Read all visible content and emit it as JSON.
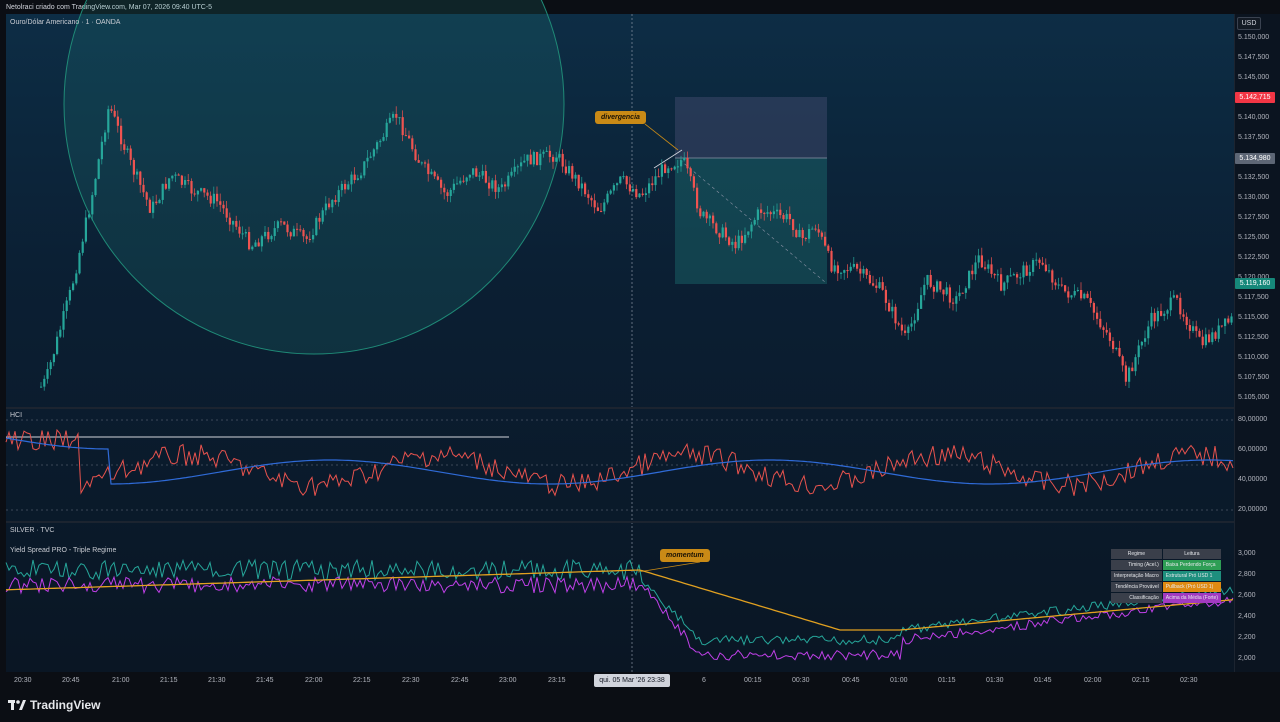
{
  "topbar": {
    "text": "Netolraci criado com TradingView.com, Mar 07, 2026 09:40 UTC-5"
  },
  "main_pane": {
    "title": "Ouro/Dólar Americano · 1 · OANDA",
    "currency_button": "USD",
    "price_ticks": [
      "5.150,000",
      "5.147,500",
      "5.145,000",
      "5.142,500",
      "5.140,000",
      "5.137,500",
      "5.132,500",
      "5.130,000",
      "5.127,500",
      "5.125,000",
      "5.122,500",
      "5.120,000",
      "5.117,500",
      "5.115,000",
      "5.112,500",
      "5.110,000",
      "5.107,500",
      "5.105,000"
    ],
    "price_tag_red": "5.142,715",
    "price_tag_grey": "5.134,980",
    "price_tag_green": "5.119,160",
    "annotation": "divergencia",
    "colors": {
      "up": "#26a69a",
      "down": "#ef5350",
      "circle": "#1f8a77"
    }
  },
  "hci_pane": {
    "title": "HCI",
    "ticks": [
      "80,00000",
      "60,00000",
      "40,00000",
      "20,00000"
    ]
  },
  "silver_pane": {
    "title": "SILVER · TVC",
    "subtitle": "Yield Spread PRO - Triple Regime",
    "ticks": [
      "3,000",
      "2,800",
      "2,600",
      "2,400",
      "2,200",
      "2,000"
    ],
    "annotation": "momentum",
    "table": {
      "headers": [
        "Regime",
        "Leitura"
      ],
      "rows": [
        {
          "key": "Timing (Acel.)",
          "value": "Baixa Perdendo Força",
          "color": "#2e9e55"
        },
        {
          "key": "Interpretação Macro",
          "value": "Estrutural Pró USD 1",
          "color": "#1e8f7e"
        },
        {
          "key": "Tendência Provável",
          "value": "Pullback (Pró USD 1)",
          "color": "#e08a12"
        },
        {
          "key": "Classificação",
          "value": "Acima da Média (Forte)",
          "color": "#a23ac0"
        }
      ]
    }
  },
  "time_axis": {
    "ticks": [
      "20:30",
      "20:45",
      "21:00",
      "21:15",
      "21:30",
      "21:45",
      "22:00",
      "22:15",
      "22:30",
      "22:45",
      "23:00",
      "23:15",
      "6",
      "00:15",
      "00:30",
      "00:45",
      "01:00",
      "01:15",
      "01:30",
      "01:45",
      "02:00",
      "02:15",
      "02:30"
    ],
    "crosshair_label": "qui. 05 Mar '26   23:38"
  },
  "footer": {
    "brand": "TradingView"
  }
}
